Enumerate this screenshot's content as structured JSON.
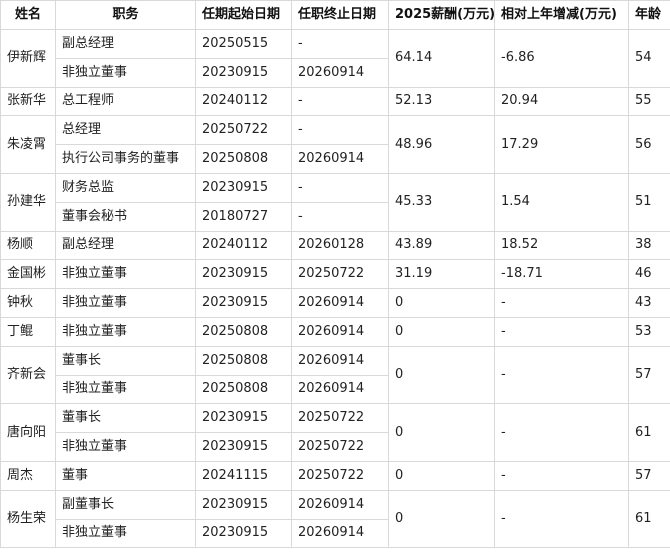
{
  "headers": [
    "姓名",
    "职务",
    "任期起始日期",
    "任职终止日期",
    "2025薪酬(万元)",
    "相对上年增减(万元)",
    "年龄"
  ],
  "people": [
    {
      "name": "伊新辉",
      "salary": "64.14",
      "change": "-6.86",
      "age": "54",
      "positions": [
        {
          "title": "副总经理",
          "start": "20250515",
          "end": "-"
        },
        {
          "title": "非独立董事",
          "start": "20230915",
          "end": "20260914"
        }
      ]
    },
    {
      "name": "张新华",
      "salary": "52.13",
      "change": "20.94",
      "age": "55",
      "positions": [
        {
          "title": "总工程师",
          "start": "20240112",
          "end": "-"
        }
      ]
    },
    {
      "name": "朱凌霄",
      "salary": "48.96",
      "change": "17.29",
      "age": "56",
      "positions": [
        {
          "title": "总经理",
          "start": "20250722",
          "end": "-"
        },
        {
          "title": "执行公司事务的董事",
          "start": "20250808",
          "end": "20260914"
        }
      ]
    },
    {
      "name": "孙建华",
      "salary": "45.33",
      "change": "1.54",
      "age": "51",
      "positions": [
        {
          "title": "财务总监",
          "start": "20230915",
          "end": "-"
        },
        {
          "title": "董事会秘书",
          "start": "20180727",
          "end": "-"
        }
      ]
    },
    {
      "name": "杨顺",
      "salary": "43.89",
      "change": "18.52",
      "age": "38",
      "positions": [
        {
          "title": "副总经理",
          "start": "20240112",
          "end": "20260128"
        }
      ]
    },
    {
      "name": "金国彬",
      "salary": "31.19",
      "change": "-18.71",
      "age": "46",
      "positions": [
        {
          "title": "非独立董事",
          "start": "20230915",
          "end": "20250722"
        }
      ]
    },
    {
      "name": "钟秋",
      "salary": "0",
      "change": "-",
      "age": "43",
      "positions": [
        {
          "title": "非独立董事",
          "start": "20230915",
          "end": "20260914"
        }
      ]
    },
    {
      "name": "丁鲲",
      "salary": "0",
      "change": "-",
      "age": "53",
      "positions": [
        {
          "title": "非独立董事",
          "start": "20250808",
          "end": "20260914"
        }
      ]
    },
    {
      "name": "齐新会",
      "salary": "0",
      "change": "-",
      "age": "57",
      "positions": [
        {
          "title": "董事长",
          "start": "20250808",
          "end": "20260914"
        },
        {
          "title": "非独立董事",
          "start": "20250808",
          "end": "20260914"
        }
      ]
    },
    {
      "name": "唐向阳",
      "salary": "0",
      "change": "-",
      "age": "61",
      "positions": [
        {
          "title": "董事长",
          "start": "20230915",
          "end": "20250722"
        },
        {
          "title": "非独立董事",
          "start": "20230915",
          "end": "20250722"
        }
      ]
    },
    {
      "name": "周杰",
      "salary": "0",
      "change": "-",
      "age": "57",
      "positions": [
        {
          "title": "董事",
          "start": "20241115",
          "end": "20250722"
        }
      ]
    },
    {
      "name": "杨生荣",
      "salary": "0",
      "change": "-",
      "age": "61",
      "positions": [
        {
          "title": "副董事长",
          "start": "20230915",
          "end": "20260914"
        },
        {
          "title": "非独立董事",
          "start": "20230915",
          "end": "20260914"
        }
      ]
    }
  ]
}
